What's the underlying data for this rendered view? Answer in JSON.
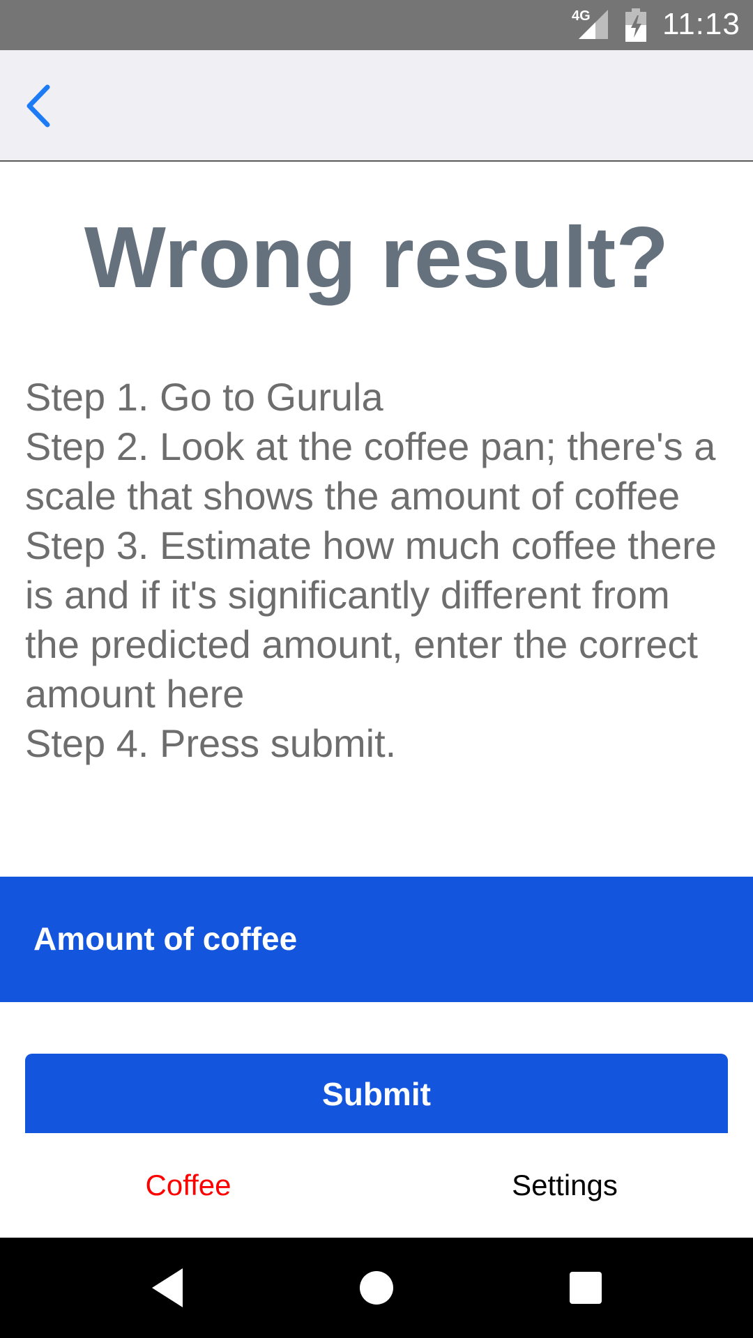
{
  "status_bar": {
    "network": "4G",
    "time": "11:13"
  },
  "header": {
    "back_icon": "chevron-left-icon"
  },
  "page": {
    "title": "Wrong result?",
    "steps": [
      "Step 1. Go to Gurula",
      "Step 2. Look at the coffee pan; there's a scale that shows the amount of coffee",
      "Step 3. Estimate how much coffee there is and if it's significantly different from the predicted amount, enter the correct amount here",
      "Step 4. Press submit."
    ],
    "amount_field": {
      "placeholder": "Amount of coffee",
      "value": ""
    },
    "submit_label": "Submit"
  },
  "tabs": [
    {
      "label": "Coffee",
      "active": true
    },
    {
      "label": "Settings",
      "active": false
    }
  ],
  "colors": {
    "accent": "#1356dd",
    "back_icon": "#1e7bf6",
    "title": "#66717e",
    "active_tab": "#ff0000",
    "inactive_tab": "#000000",
    "header_bg": "#efeff4",
    "status_bar_bg": "#757575"
  }
}
